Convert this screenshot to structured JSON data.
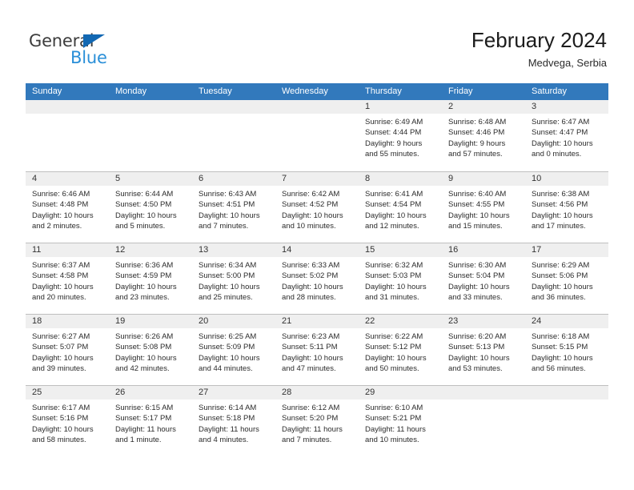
{
  "brand": {
    "name_part1": "General",
    "name_part2": "Blue",
    "color_dark": "#3d3d3d",
    "color_blue": "#2a8fd8",
    "triangle_color": "#1268b3"
  },
  "header": {
    "title": "February 2024",
    "subtitle": "Medvega, Serbia",
    "header_bg": "#3279BC",
    "daynum_bg": "#EFEFEF"
  },
  "weekdays": [
    "Sunday",
    "Monday",
    "Tuesday",
    "Wednesday",
    "Thursday",
    "Friday",
    "Saturday"
  ],
  "weeks": [
    [
      {
        "day": "",
        "empty": true
      },
      {
        "day": "",
        "empty": true
      },
      {
        "day": "",
        "empty": true
      },
      {
        "day": "",
        "empty": true
      },
      {
        "day": "1",
        "sunrise": "Sunrise: 6:49 AM",
        "sunset": "Sunset: 4:44 PM",
        "daylight1": "Daylight: 9 hours",
        "daylight2": "and 55 minutes."
      },
      {
        "day": "2",
        "sunrise": "Sunrise: 6:48 AM",
        "sunset": "Sunset: 4:46 PM",
        "daylight1": "Daylight: 9 hours",
        "daylight2": "and 57 minutes."
      },
      {
        "day": "3",
        "sunrise": "Sunrise: 6:47 AM",
        "sunset": "Sunset: 4:47 PM",
        "daylight1": "Daylight: 10 hours",
        "daylight2": "and 0 minutes."
      }
    ],
    [
      {
        "day": "4",
        "sunrise": "Sunrise: 6:46 AM",
        "sunset": "Sunset: 4:48 PM",
        "daylight1": "Daylight: 10 hours",
        "daylight2": "and 2 minutes."
      },
      {
        "day": "5",
        "sunrise": "Sunrise: 6:44 AM",
        "sunset": "Sunset: 4:50 PM",
        "daylight1": "Daylight: 10 hours",
        "daylight2": "and 5 minutes."
      },
      {
        "day": "6",
        "sunrise": "Sunrise: 6:43 AM",
        "sunset": "Sunset: 4:51 PM",
        "daylight1": "Daylight: 10 hours",
        "daylight2": "and 7 minutes."
      },
      {
        "day": "7",
        "sunrise": "Sunrise: 6:42 AM",
        "sunset": "Sunset: 4:52 PM",
        "daylight1": "Daylight: 10 hours",
        "daylight2": "and 10 minutes."
      },
      {
        "day": "8",
        "sunrise": "Sunrise: 6:41 AM",
        "sunset": "Sunset: 4:54 PM",
        "daylight1": "Daylight: 10 hours",
        "daylight2": "and 12 minutes."
      },
      {
        "day": "9",
        "sunrise": "Sunrise: 6:40 AM",
        "sunset": "Sunset: 4:55 PM",
        "daylight1": "Daylight: 10 hours",
        "daylight2": "and 15 minutes."
      },
      {
        "day": "10",
        "sunrise": "Sunrise: 6:38 AM",
        "sunset": "Sunset: 4:56 PM",
        "daylight1": "Daylight: 10 hours",
        "daylight2": "and 17 minutes."
      }
    ],
    [
      {
        "day": "11",
        "sunrise": "Sunrise: 6:37 AM",
        "sunset": "Sunset: 4:58 PM",
        "daylight1": "Daylight: 10 hours",
        "daylight2": "and 20 minutes."
      },
      {
        "day": "12",
        "sunrise": "Sunrise: 6:36 AM",
        "sunset": "Sunset: 4:59 PM",
        "daylight1": "Daylight: 10 hours",
        "daylight2": "and 23 minutes."
      },
      {
        "day": "13",
        "sunrise": "Sunrise: 6:34 AM",
        "sunset": "Sunset: 5:00 PM",
        "daylight1": "Daylight: 10 hours",
        "daylight2": "and 25 minutes."
      },
      {
        "day": "14",
        "sunrise": "Sunrise: 6:33 AM",
        "sunset": "Sunset: 5:02 PM",
        "daylight1": "Daylight: 10 hours",
        "daylight2": "and 28 minutes."
      },
      {
        "day": "15",
        "sunrise": "Sunrise: 6:32 AM",
        "sunset": "Sunset: 5:03 PM",
        "daylight1": "Daylight: 10 hours",
        "daylight2": "and 31 minutes."
      },
      {
        "day": "16",
        "sunrise": "Sunrise: 6:30 AM",
        "sunset": "Sunset: 5:04 PM",
        "daylight1": "Daylight: 10 hours",
        "daylight2": "and 33 minutes."
      },
      {
        "day": "17",
        "sunrise": "Sunrise: 6:29 AM",
        "sunset": "Sunset: 5:06 PM",
        "daylight1": "Daylight: 10 hours",
        "daylight2": "and 36 minutes."
      }
    ],
    [
      {
        "day": "18",
        "sunrise": "Sunrise: 6:27 AM",
        "sunset": "Sunset: 5:07 PM",
        "daylight1": "Daylight: 10 hours",
        "daylight2": "and 39 minutes."
      },
      {
        "day": "19",
        "sunrise": "Sunrise: 6:26 AM",
        "sunset": "Sunset: 5:08 PM",
        "daylight1": "Daylight: 10 hours",
        "daylight2": "and 42 minutes."
      },
      {
        "day": "20",
        "sunrise": "Sunrise: 6:25 AM",
        "sunset": "Sunset: 5:09 PM",
        "daylight1": "Daylight: 10 hours",
        "daylight2": "and 44 minutes."
      },
      {
        "day": "21",
        "sunrise": "Sunrise: 6:23 AM",
        "sunset": "Sunset: 5:11 PM",
        "daylight1": "Daylight: 10 hours",
        "daylight2": "and 47 minutes."
      },
      {
        "day": "22",
        "sunrise": "Sunrise: 6:22 AM",
        "sunset": "Sunset: 5:12 PM",
        "daylight1": "Daylight: 10 hours",
        "daylight2": "and 50 minutes."
      },
      {
        "day": "23",
        "sunrise": "Sunrise: 6:20 AM",
        "sunset": "Sunset: 5:13 PM",
        "daylight1": "Daylight: 10 hours",
        "daylight2": "and 53 minutes."
      },
      {
        "day": "24",
        "sunrise": "Sunrise: 6:18 AM",
        "sunset": "Sunset: 5:15 PM",
        "daylight1": "Daylight: 10 hours",
        "daylight2": "and 56 minutes."
      }
    ],
    [
      {
        "day": "25",
        "sunrise": "Sunrise: 6:17 AM",
        "sunset": "Sunset: 5:16 PM",
        "daylight1": "Daylight: 10 hours",
        "daylight2": "and 58 minutes."
      },
      {
        "day": "26",
        "sunrise": "Sunrise: 6:15 AM",
        "sunset": "Sunset: 5:17 PM",
        "daylight1": "Daylight: 11 hours",
        "daylight2": "and 1 minute."
      },
      {
        "day": "27",
        "sunrise": "Sunrise: 6:14 AM",
        "sunset": "Sunset: 5:18 PM",
        "daylight1": "Daylight: 11 hours",
        "daylight2": "and 4 minutes."
      },
      {
        "day": "28",
        "sunrise": "Sunrise: 6:12 AM",
        "sunset": "Sunset: 5:20 PM",
        "daylight1": "Daylight: 11 hours",
        "daylight2": "and 7 minutes."
      },
      {
        "day": "29",
        "sunrise": "Sunrise: 6:10 AM",
        "sunset": "Sunset: 5:21 PM",
        "daylight1": "Daylight: 11 hours",
        "daylight2": "and 10 minutes."
      },
      {
        "day": "",
        "empty": true
      },
      {
        "day": "",
        "empty": true
      }
    ]
  ]
}
